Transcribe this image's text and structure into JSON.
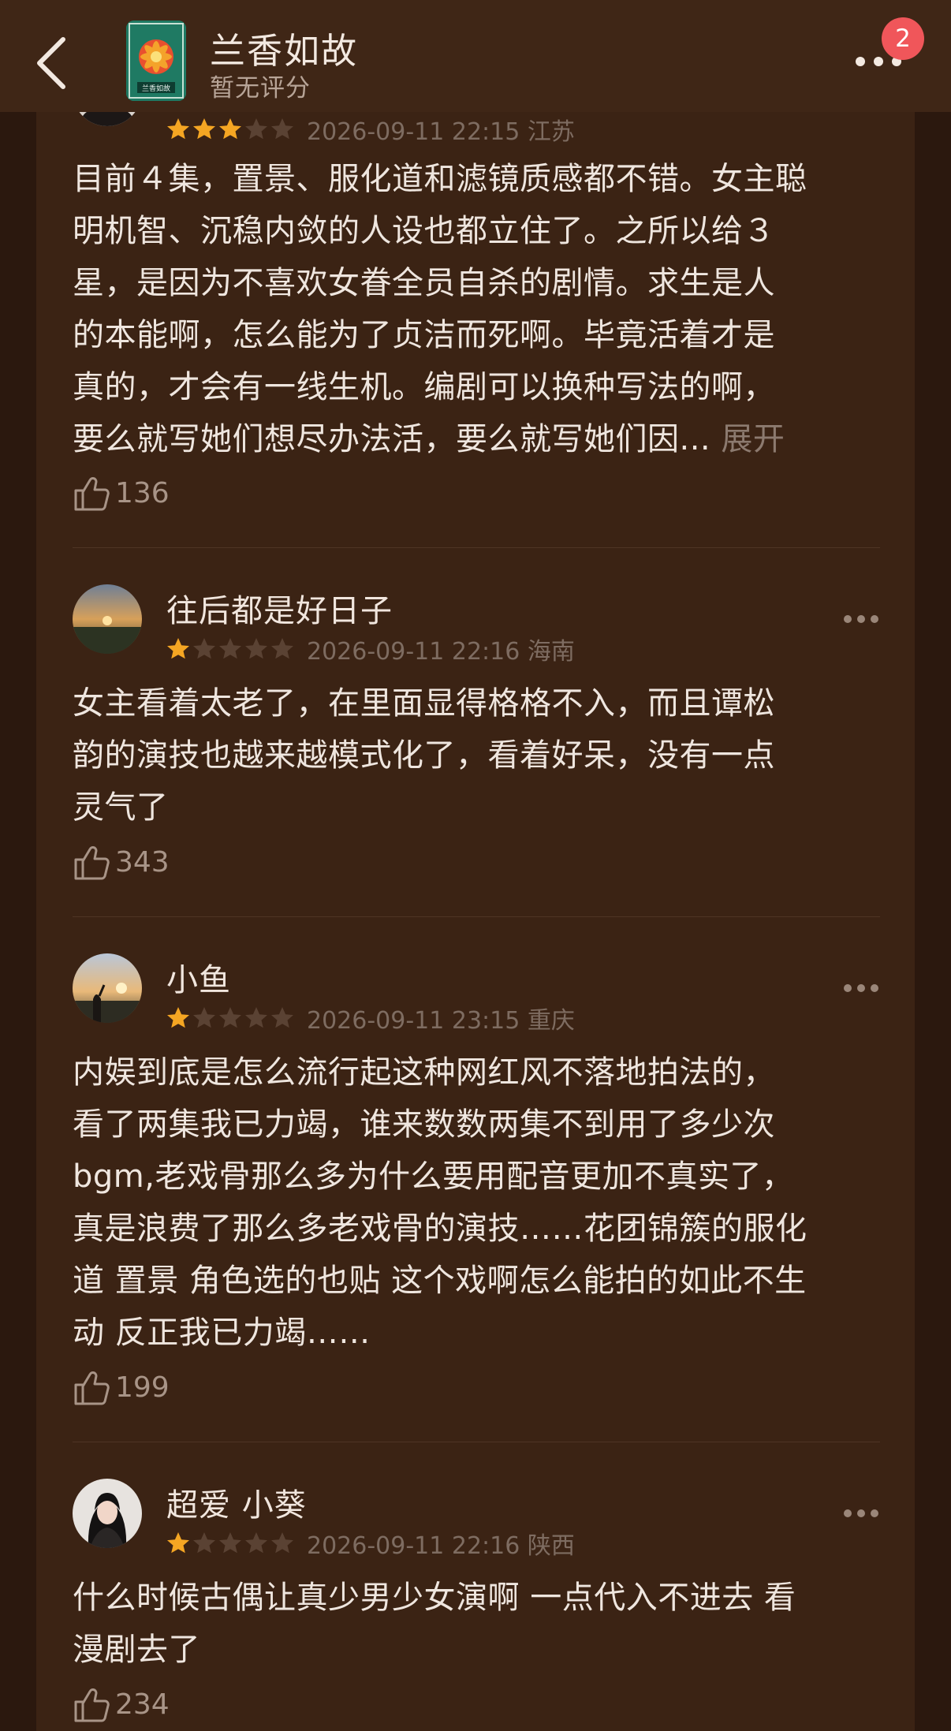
{
  "header": {
    "title": "兰香如故",
    "subtitle": "暂无评分",
    "badge_count": "2",
    "cover_text": "兰香如故"
  },
  "colors": {
    "background": "#3b2314",
    "star_active": "#f5a623",
    "star_inactive": "#5a4233",
    "badge": "#f0565a"
  },
  "comments": [
    {
      "username": "",
      "rating": 3,
      "meta": "2026-09-11 22:15 江苏",
      "lines": [
        "目前４集，置景、服化道和滤镜质感都不错。女主聪",
        "明机智、沉稳内敛的人设也都立住了。之所以给３",
        "星，是因为不喜欢女眷全员自杀的剧情。求生是人",
        "的本能啊，怎么能为了贞洁而死啊。毕竟活着才是",
        "真的，才会有一线生机。编剧可以换种写法的啊，",
        "要么就写她们想尽办法活，要么就写她们因..."
      ],
      "expand_label": "展开",
      "likes": "136"
    },
    {
      "username": "往后都是好日子",
      "rating": 1,
      "meta": "2026-09-11 22:16 海南",
      "lines": [
        "女主看着太老了，在里面显得格格不入，而且谭松",
        "韵的演技也越来越模式化了，看着好呆，没有一点",
        "灵气了"
      ],
      "likes": "343"
    },
    {
      "username": "小鱼",
      "rating": 1,
      "meta": "2026-09-11 23:15 重庆",
      "lines": [
        "内娱到底是怎么流行起这种网红风不落地拍法的，",
        "看了两集我已力竭，谁来数数两集不到用了多少次",
        "bgm,老戏骨那么多为什么要用配音更加不真实了，",
        "真是浪费了那么多老戏骨的演技……花团锦簇的服化",
        "道 置景 角色选的也贴 这个戏啊怎么能拍的如此不生",
        "动 反正我已力竭……"
      ],
      "likes": "199"
    },
    {
      "username": "超爱 小葵",
      "rating": 1,
      "meta": "2026-09-11 22:16 陕西",
      "lines": [
        "什么时候古偶让真少男少女演啊 一点代入不进去  看",
        "漫剧去了"
      ],
      "likes": "234"
    }
  ]
}
